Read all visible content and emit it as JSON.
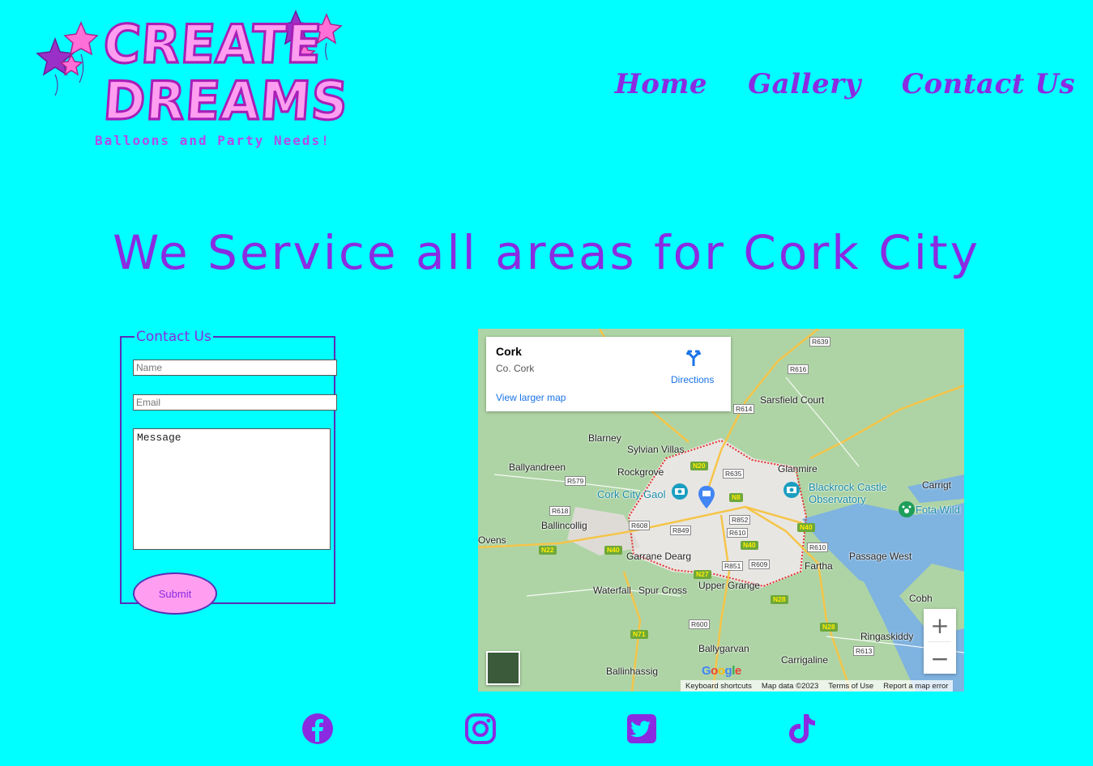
{
  "brand": {
    "line1": "CREATE",
    "line2": "DREAMS",
    "tagline": "Balloons and Party Needs!"
  },
  "nav": {
    "home": "Home",
    "gallery": "Gallery",
    "contact": "Contact Us"
  },
  "headline": "We Service all areas for Cork City",
  "form": {
    "legend": "Contact Us",
    "name_placeholder": "Name",
    "email_placeholder": "Email",
    "message_placeholder": "Message",
    "submit_label": "Submit"
  },
  "map": {
    "card_title": "Cork",
    "card_subtitle": "Co. Cork",
    "directions_label": "Directions",
    "larger_map_label": "View larger map",
    "places": [
      "Blarney",
      "Sylvian Villas",
      "Ballyandreen",
      "Rockgrove",
      "Sarsfield Court",
      "Glanmire",
      "Cork City Gaol",
      "Blackrock Castle",
      "Observatory",
      "Carrigt",
      "Fota Wild",
      "Ballincollig",
      "Ovens",
      "Garrane Dearg",
      "Fartha",
      "Passage West",
      "Waterfall",
      "Spur Cross",
      "Upper Grange",
      "Cobh",
      "Ringaskiddy",
      "Ballygarvan",
      "Ballinhassig",
      "Carrigaline"
    ],
    "roads": [
      "R639",
      "R616",
      "R614",
      "R635",
      "R579",
      "R618",
      "R608",
      "R849",
      "R852",
      "R610",
      "R610",
      "R851",
      "R609",
      "R600",
      "R613"
    ],
    "national_roads": [
      "N20",
      "N8",
      "N40",
      "N40",
      "N22",
      "N40",
      "N27",
      "N28",
      "N28",
      "N71"
    ],
    "google": "Google",
    "attribution": [
      "Keyboard shortcuts",
      "Map data ©2023",
      "Terms of Use",
      "Report a map error"
    ]
  },
  "social": [
    "facebook-icon",
    "instagram-icon",
    "twitter-icon",
    "tiktok-icon"
  ],
  "colors": {
    "background": "#00ffff",
    "accent": "#8a2be2",
    "pink": "#ff9ef0"
  }
}
